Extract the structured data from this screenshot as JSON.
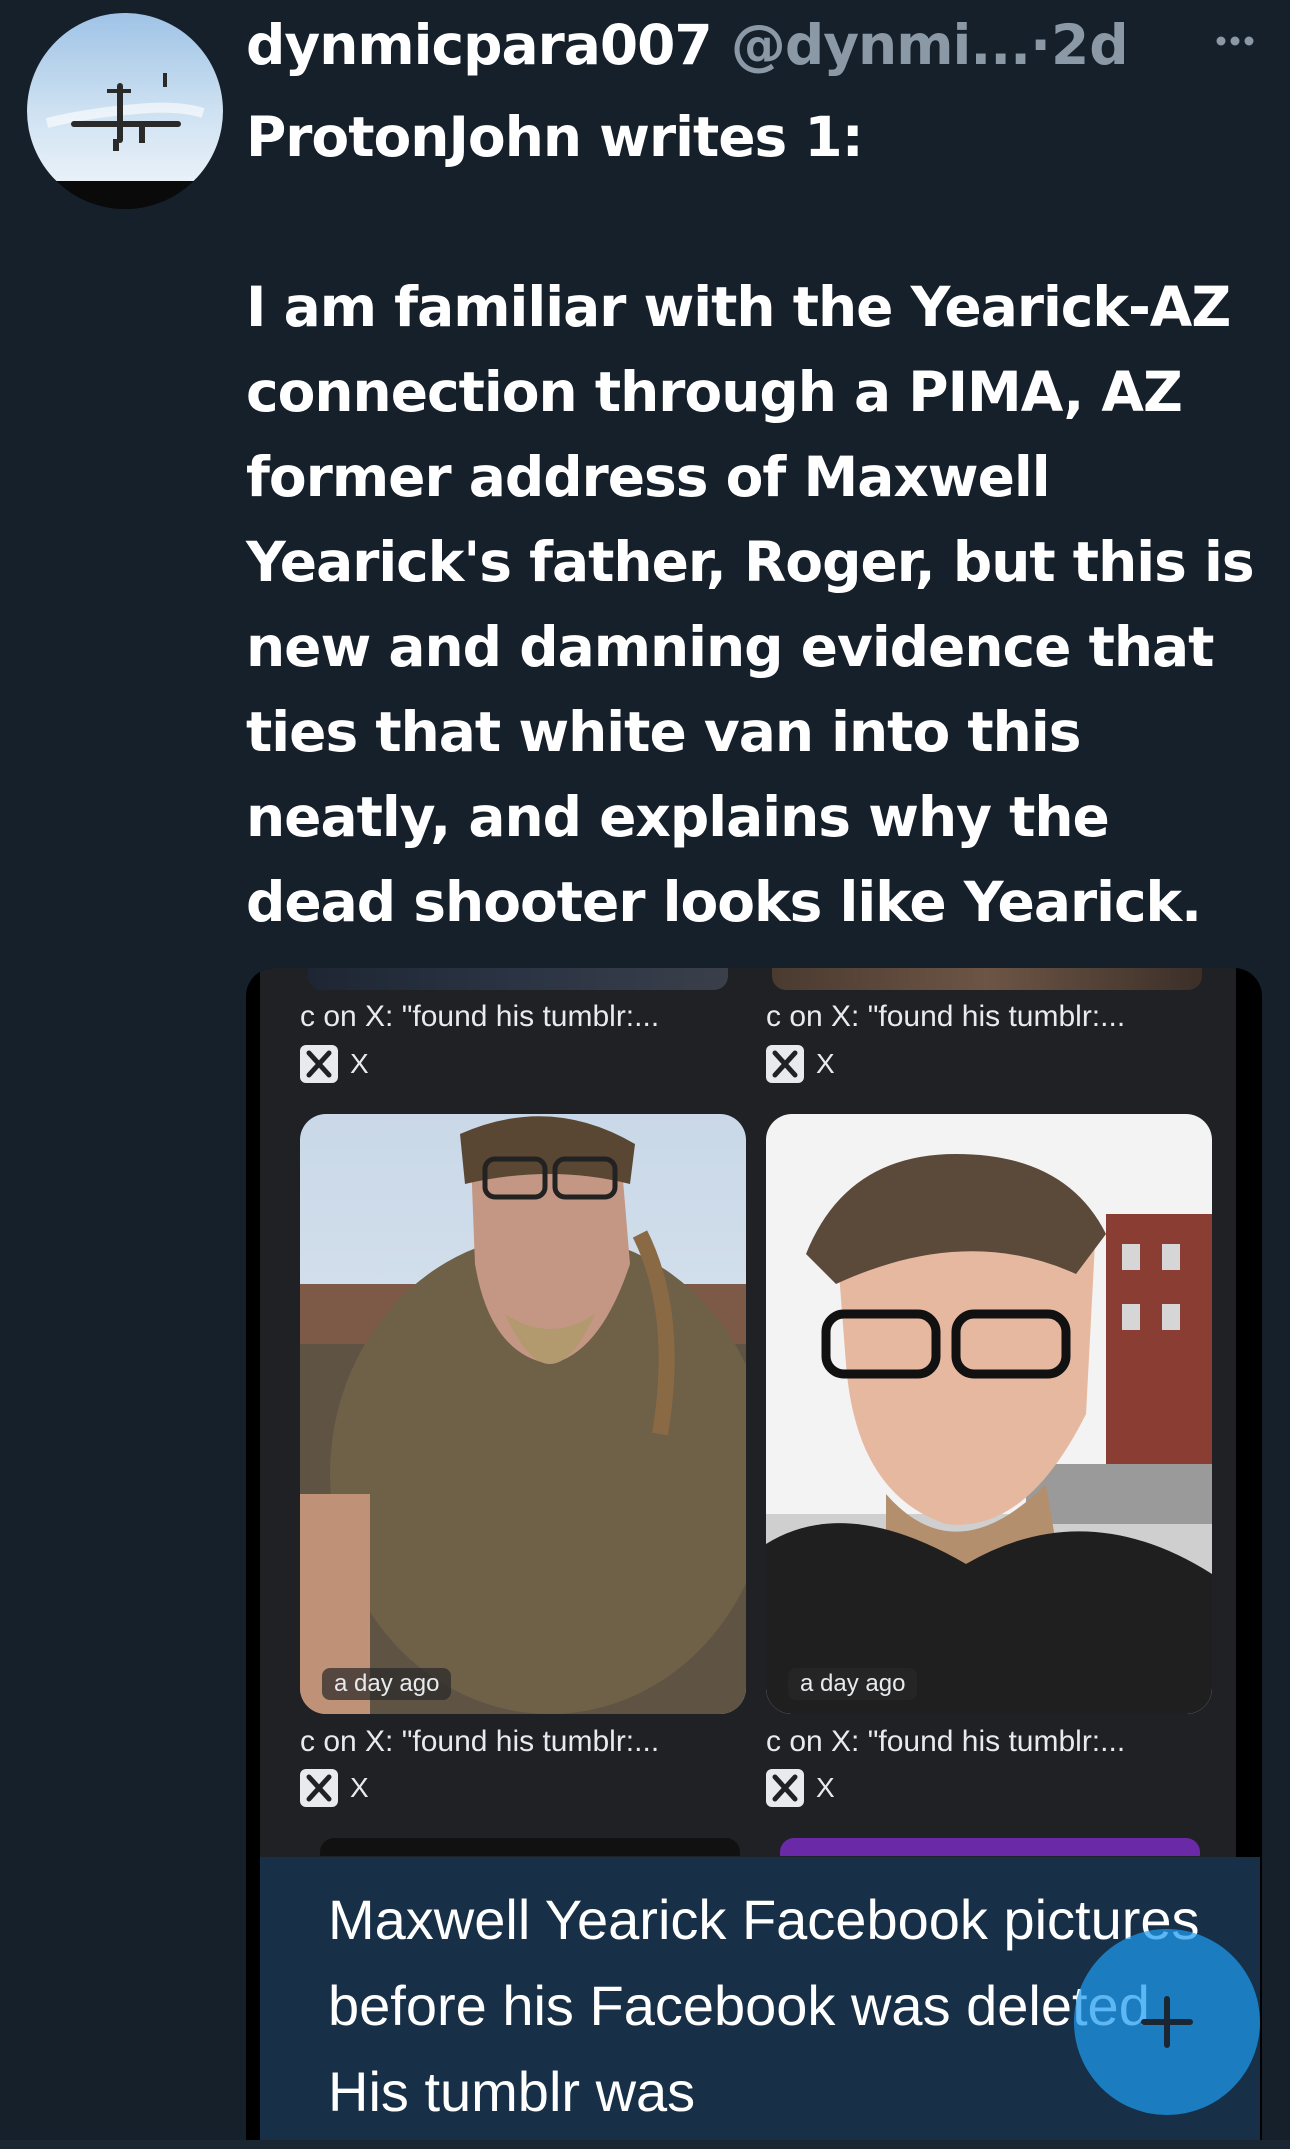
{
  "tweet": {
    "display_name": "dynmicpara007",
    "handle": "@dynmi...",
    "separator": "·",
    "timestamp": "2d",
    "text_lines": [
      "ProtonJohn writes 1:",
      "I am familiar with the Yearick-AZ connection through a PIMA, AZ former address of Maxwell Yearick's father, Roger, but this is new and damning evidence that ties that white van into this neatly, and explains why the dead shooter looks like Yearick."
    ]
  },
  "media": {
    "results": [
      {
        "caption": "c on X: \"found his tumblr:...",
        "source": "X",
        "age": "a day ago"
      },
      {
        "caption": "c on X: \"found his tumblr:...",
        "source": "X",
        "age": "a day ago"
      },
      {
        "caption": "c on X: \"found his tumblr:...",
        "source": "X"
      },
      {
        "caption": "c on X: \"found his tumblr:...",
        "source": "X"
      }
    ],
    "overlay_text": "Maxwell Yearick Facebook pictures before his Facebook was deleted. His tumblr was"
  },
  "icons": {
    "more": "more-horizontal-icon",
    "compose": "plus-icon",
    "x_logo": "x-logo-icon"
  },
  "colors": {
    "background": "#15202b",
    "secondary_text": "#8b98a5",
    "fab": "#1d9bf0",
    "overlay_box": "#173047"
  }
}
